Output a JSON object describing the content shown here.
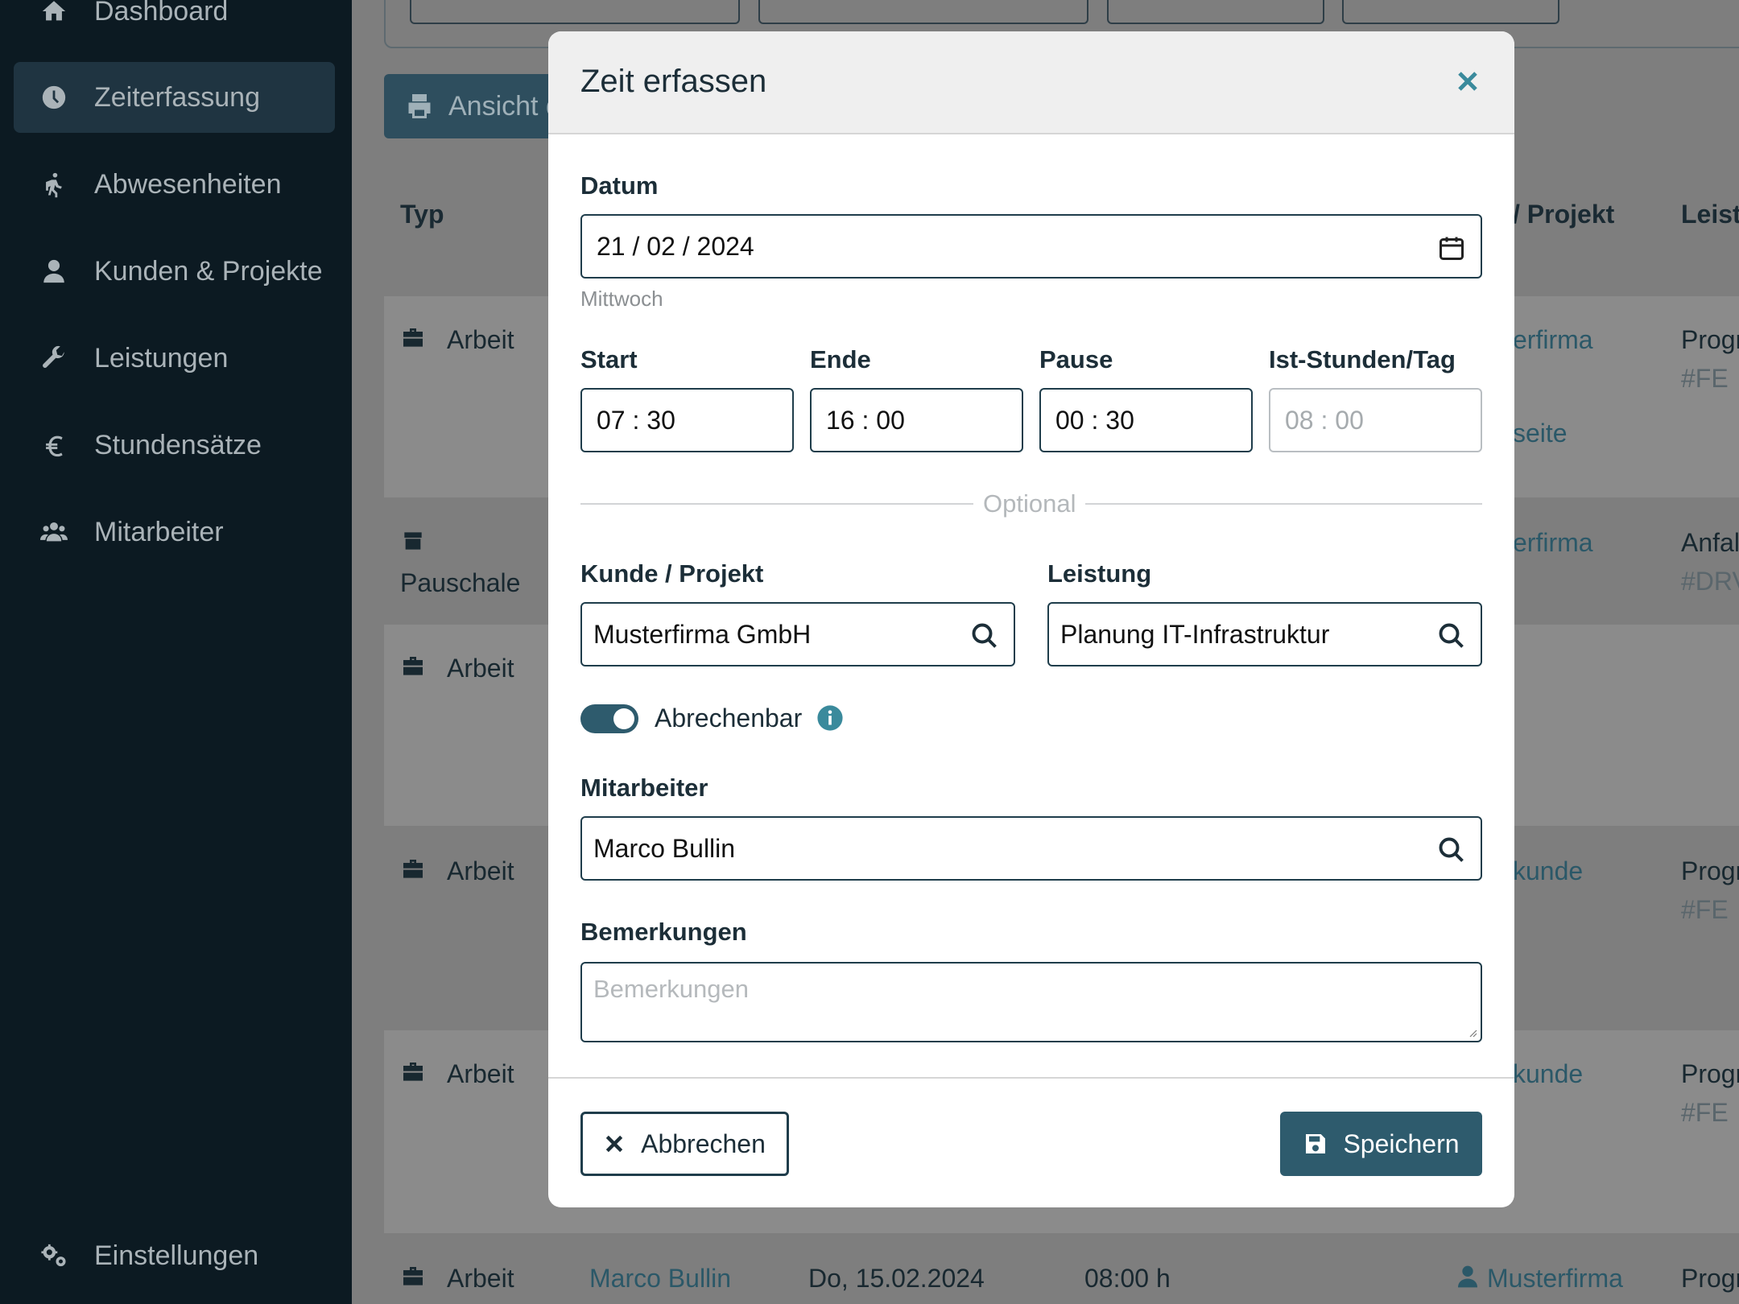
{
  "sidebar": {
    "items": [
      {
        "label": "Dashboard",
        "icon": "home-icon"
      },
      {
        "label": "Zeiterfassung",
        "icon": "clock-icon",
        "active": true
      },
      {
        "label": "Abwesenheiten",
        "icon": "walking-icon"
      },
      {
        "label": "Kunden & Projekte",
        "icon": "user-icon"
      },
      {
        "label": "Leistungen",
        "icon": "wrench-icon"
      },
      {
        "label": "Stundensätze",
        "icon": "euro-icon"
      },
      {
        "label": "Mitarbeiter",
        "icon": "users-icon"
      }
    ],
    "settings_label": "Einstellungen"
  },
  "background": {
    "print_button_label": "Ansicht d",
    "table_headers": {
      "type": "Typ",
      "project": "/ Projekt",
      "service": "Leist"
    },
    "rows": [
      {
        "type": "Arbeit",
        "project": "erfirma",
        "project2": "seite",
        "service": "Progr",
        "service2": "#FE"
      },
      {
        "type": "Pauschale",
        "project": "erfirma",
        "service": "Anfal",
        "service2": "#DRV"
      },
      {
        "type": "Arbeit"
      },
      {
        "type": "Arbeit",
        "project": "kunde",
        "service": "Progr",
        "service2": "#FE"
      },
      {
        "type": "Arbeit",
        "project": "kunde",
        "service": "Progr",
        "service2": "#FE"
      },
      {
        "type": "Arbeit",
        "employee": "Marco Bullin",
        "date": "Do, 15.02.2024",
        "hours": "08:00 h",
        "project": "Musterfirma",
        "service": "Progr"
      }
    ]
  },
  "modal": {
    "title": "Zeit erfassen",
    "date": {
      "label": "Datum",
      "value": "21 / 02 / 2024",
      "weekday": "Mittwoch"
    },
    "start": {
      "label": "Start",
      "value": "07 : 30"
    },
    "end": {
      "label": "Ende",
      "value": "16 : 00"
    },
    "pause": {
      "label": "Pause",
      "value": "00 : 30"
    },
    "actual": {
      "label": "Ist-Stunden/Tag",
      "value": "08 : 00"
    },
    "optional_label": "Optional",
    "customer": {
      "label": "Kunde / Projekt",
      "value": "Musterfirma GmbH"
    },
    "service": {
      "label": "Leistung",
      "value": "Planung IT-Infrastruktur"
    },
    "billable": {
      "label": "Abrechenbar",
      "on": true
    },
    "employee": {
      "label": "Mitarbeiter",
      "value": "Marco Bullin"
    },
    "remarks": {
      "label": "Bemerkungen",
      "placeholder": "Bemerkungen"
    },
    "cancel_label": "Abbrechen",
    "save_label": "Speichern"
  },
  "colors": {
    "accent": "#2e5b6d",
    "close": "#3a8a9c",
    "sidebar": "#0c1a22"
  }
}
